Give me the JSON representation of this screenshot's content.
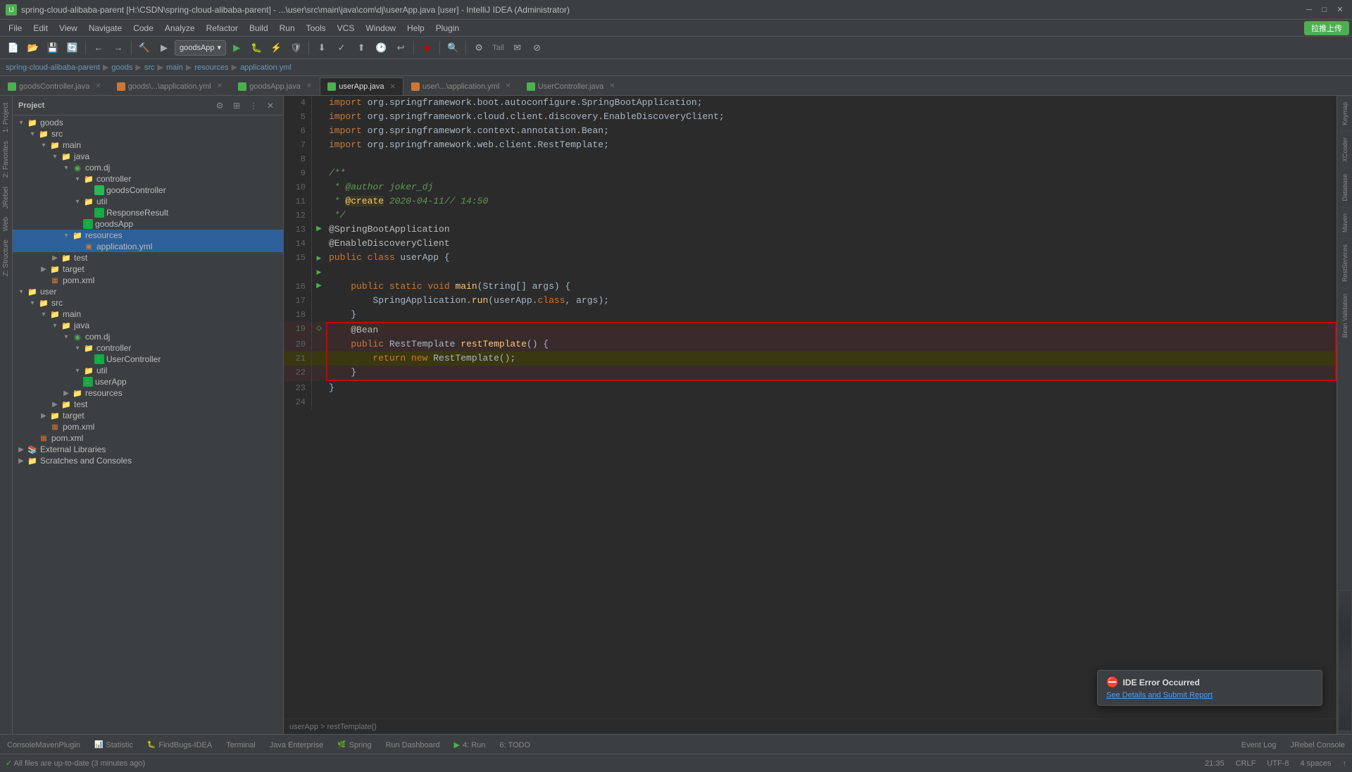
{
  "titleBar": {
    "title": "spring-cloud-alibaba-parent [H:\\CSDN\\spring-cloud-alibaba-parent] - ...\\user\\src\\main\\java\\com\\dj\\userApp.java [user] - IntelliJ IDEA (Administrator)",
    "icon": "IJ"
  },
  "menuBar": {
    "items": [
      "File",
      "Edit",
      "View",
      "Navigate",
      "Code",
      "Analyze",
      "Refactor",
      "Build",
      "Run",
      "Tools",
      "VCS",
      "Window",
      "Help",
      "Plugin"
    ]
  },
  "toolbar": {
    "dropdown": "goodsApp",
    "remoteBtn": "拉推上传"
  },
  "breadcrumb": {
    "parts": [
      "spring-cloud-alibaba-parent",
      "goods",
      "src",
      "main",
      "resources",
      "application.yml"
    ]
  },
  "tabs": [
    {
      "label": "goodsController.java",
      "type": "java",
      "active": false
    },
    {
      "label": "goods\\...\\application.yml",
      "type": "yml",
      "active": false
    },
    {
      "label": "goodsApp.java",
      "type": "java",
      "active": false
    },
    {
      "label": "userApp.java",
      "type": "java",
      "active": true
    },
    {
      "label": "user\\...\\application.yml",
      "type": "yml",
      "active": false
    },
    {
      "label": "UserController.java",
      "type": "java",
      "active": false
    }
  ],
  "projectTree": {
    "title": "Project",
    "items": [
      {
        "indent": 0,
        "arrow": "▾",
        "icon": "folder",
        "label": "goods",
        "level": 0
      },
      {
        "indent": 1,
        "arrow": "▾",
        "icon": "folder",
        "label": "src",
        "level": 1
      },
      {
        "indent": 2,
        "arrow": "▾",
        "icon": "folder",
        "label": "main",
        "level": 2
      },
      {
        "indent": 3,
        "arrow": "▾",
        "icon": "folder",
        "label": "java",
        "level": 3
      },
      {
        "indent": 4,
        "arrow": "▾",
        "icon": "package",
        "label": "com.dj",
        "level": 4
      },
      {
        "indent": 5,
        "arrow": "▾",
        "icon": "folder",
        "label": "controller",
        "level": 5
      },
      {
        "indent": 6,
        "arrow": " ",
        "icon": "java",
        "label": "goodsController",
        "level": 6
      },
      {
        "indent": 5,
        "arrow": "▾",
        "icon": "folder",
        "label": "util",
        "level": 5
      },
      {
        "indent": 6,
        "arrow": " ",
        "icon": "java",
        "label": "ResponseResult",
        "level": 6
      },
      {
        "indent": 5,
        "arrow": " ",
        "icon": "java",
        "label": "goodsApp",
        "level": 5
      },
      {
        "indent": 4,
        "arrow": "▾",
        "icon": "folder",
        "label": "resources",
        "level": 4,
        "selected": true
      },
      {
        "indent": 5,
        "arrow": " ",
        "icon": "yml",
        "label": "application.yml",
        "level": 5,
        "selected": true
      },
      {
        "indent": 3,
        "arrow": "▶",
        "icon": "folder",
        "label": "test",
        "level": 3
      },
      {
        "indent": 2,
        "arrow": "▶",
        "icon": "folder",
        "label": "target",
        "level": 2
      },
      {
        "indent": 2,
        "arrow": " ",
        "icon": "xml",
        "label": "pom.xml",
        "level": 2
      },
      {
        "indent": 0,
        "arrow": "▾",
        "icon": "folder",
        "label": "user",
        "level": 0
      },
      {
        "indent": 1,
        "arrow": "▾",
        "icon": "folder",
        "label": "src",
        "level": 1
      },
      {
        "indent": 2,
        "arrow": "▾",
        "icon": "folder",
        "label": "main",
        "level": 2
      },
      {
        "indent": 3,
        "arrow": "▾",
        "icon": "folder",
        "label": "java",
        "level": 3
      },
      {
        "indent": 4,
        "arrow": "▾",
        "icon": "package",
        "label": "com.dj",
        "level": 4
      },
      {
        "indent": 5,
        "arrow": "▾",
        "icon": "folder",
        "label": "controller",
        "level": 5
      },
      {
        "indent": 6,
        "arrow": " ",
        "icon": "java",
        "label": "UserController",
        "level": 6
      },
      {
        "indent": 5,
        "arrow": "▾",
        "icon": "folder",
        "label": "util",
        "level": 5
      },
      {
        "indent": 5,
        "arrow": " ",
        "icon": "java",
        "label": "userApp",
        "level": 5
      },
      {
        "indent": 4,
        "arrow": "▶",
        "icon": "folder",
        "label": "resources",
        "level": 4
      },
      {
        "indent": 3,
        "arrow": "▶",
        "icon": "folder",
        "label": "test",
        "level": 3
      },
      {
        "indent": 2,
        "arrow": "▶",
        "icon": "folder",
        "label": "target",
        "level": 2
      },
      {
        "indent": 2,
        "arrow": " ",
        "icon": "xml",
        "label": "pom.xml",
        "level": 2
      },
      {
        "indent": 1,
        "arrow": " ",
        "icon": "xml",
        "label": "pom.xml",
        "level": 1
      },
      {
        "indent": 0,
        "arrow": "▶",
        "icon": "folder",
        "label": "External Libraries",
        "level": 0
      },
      {
        "indent": 0,
        "arrow": "▶",
        "icon": "folder",
        "label": "Scratches and Consoles",
        "level": 0
      }
    ]
  },
  "codeEditor": {
    "lines": [
      {
        "num": "4",
        "gutter": "",
        "content": "import org.springframework.boot.autoconfigure.SpringBootApplication;"
      },
      {
        "num": "5",
        "gutter": "",
        "content": "import org.springframework.cloud.client.discovery.EnableDiscoveryClient;"
      },
      {
        "num": "6",
        "gutter": "",
        "content": "import org.springframework.context.annotation.Bean;"
      },
      {
        "num": "7",
        "gutter": "",
        "content": "import org.springframework.web.client.RestTemplate;"
      },
      {
        "num": "8",
        "gutter": "",
        "content": ""
      },
      {
        "num": "9",
        "gutter": "",
        "content": "/**"
      },
      {
        "num": "10",
        "gutter": "",
        "content": " * @author joker_dj"
      },
      {
        "num": "11",
        "gutter": "",
        "content": " * @create 2020-04-11// 14:50"
      },
      {
        "num": "12",
        "gutter": "",
        "content": " */"
      },
      {
        "num": "13",
        "gutter": "run",
        "content": "@SpringBootApplication"
      },
      {
        "num": "14",
        "gutter": "",
        "content": "@EnableDiscoveryClient"
      },
      {
        "num": "15",
        "gutter": "run",
        "content": "public class userApp {"
      },
      {
        "num": "16",
        "gutter": "arrow",
        "content": "    public static void main(String[] args) {"
      },
      {
        "num": "17",
        "gutter": "",
        "content": "        SpringApplication.run(userApp.class, args);"
      },
      {
        "num": "18",
        "gutter": "",
        "content": "    }"
      },
      {
        "num": "19",
        "gutter": "",
        "content": "    @Bean",
        "redBox": true
      },
      {
        "num": "20",
        "gutter": "",
        "content": "    public RestTemplate restTemplate() {",
        "redBox": true
      },
      {
        "num": "21",
        "gutter": "",
        "content": "        return new RestTemplate();",
        "redBox": true,
        "yellow": true
      },
      {
        "num": "22",
        "gutter": "",
        "content": "    }",
        "redBox": true
      },
      {
        "num": "23",
        "gutter": "",
        "content": "}"
      },
      {
        "num": "24",
        "gutter": "",
        "content": ""
      }
    ]
  },
  "editorBreadcrumb": "userApp > restTemplate()",
  "bottomTabs": [
    {
      "label": "ConsoleMavenPlugin",
      "active": false
    },
    {
      "label": "Statistic",
      "active": false
    },
    {
      "label": "FindBugs-IDEA",
      "active": false
    },
    {
      "label": "Terminal",
      "active": false
    },
    {
      "label": "Java Enterprise",
      "active": false
    },
    {
      "label": "Spring",
      "active": false
    },
    {
      "label": "Run Dashboard",
      "active": false
    },
    {
      "label": "4: Run",
      "active": false
    },
    {
      "label": "6: TODO",
      "active": false
    },
    {
      "label": "Event Log",
      "active": false
    },
    {
      "label": "JRebel Console",
      "active": false
    }
  ],
  "statusBar": {
    "left": "All files are up-to-date (3 minutes ago)",
    "line": "21:35",
    "encoding": "CRLF",
    "charset": "UTF-8",
    "indent": "4 spaces",
    "lang": "↑"
  },
  "rightTools": [
    {
      "label": "Keymap"
    },
    {
      "label": "XCcoder"
    },
    {
      "label": "Database"
    },
    {
      "label": "Maven"
    },
    {
      "label": "RestServices"
    },
    {
      "label": "Bean Validation"
    }
  ],
  "leftTools": [
    {
      "label": "1: Project"
    },
    {
      "label": "2: Favorites"
    },
    {
      "label": "JRebel"
    },
    {
      "label": "Web"
    },
    {
      "label": "Z: Structure"
    }
  ],
  "errorNotification": {
    "title": "IDE Error Occurred",
    "link": "See Details and Submit Report"
  }
}
